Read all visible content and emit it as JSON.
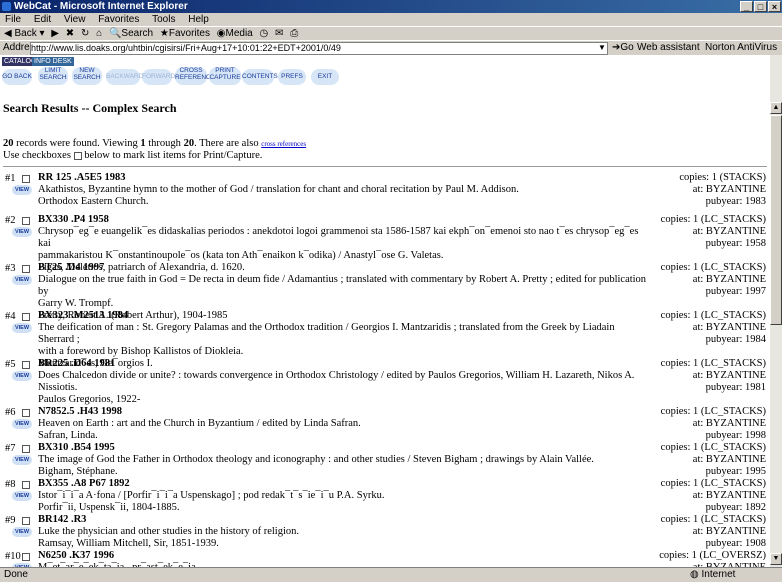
{
  "window": {
    "title": "WebCat - Microsoft Internet Explorer"
  },
  "menu": [
    "File",
    "Edit",
    "View",
    "Favorites",
    "Tools",
    "Help"
  ],
  "toolbar": {
    "back": "Back",
    "search": "Search",
    "favorites": "Favorites",
    "media": "Media"
  },
  "address": {
    "label": "Address",
    "url": "http://www.lis.doaks.org/uhtbin/cgisirsi/Fri+Aug+17+10:01:22+EDT+2001/0/49",
    "go": "Go",
    "assistant": "Web assistant",
    "antivirus": "Norton AntiVirus"
  },
  "nav": {
    "catalog": "CATALOG",
    "infodesk": "INFO DESK",
    "buttons": [
      "GO BACK",
      "LIMIT SEARCH",
      "NEW SEARCH",
      "BACKWARD",
      "FORWARD",
      "CROSS REFERENCE",
      "PRINT CAPTURE",
      "CONTENTS",
      "PREFS",
      "EXIT"
    ]
  },
  "heading": "Search Results -- Complex Search",
  "summary": {
    "count": "20",
    "a": " records were found. Viewing ",
    "from": "1",
    "b": " through ",
    "to": "20",
    "c": ". There are also ",
    "link": "cross references",
    "line2a": "Use checkboxes",
    "line2b": " below to mark list items for Print/Capture."
  },
  "view_label": "VIEW",
  "records": [
    {
      "num": "#1",
      "call": "RR 125 .A5E5 1983",
      "lines": [
        "Akathistos, Byzantine hymn to the mother of God / translation for chant and choral recitation by Paul M. Addison.",
        "Orthodox Eastern Church."
      ],
      "copies": "copies: 1 (STACKS)",
      "at": "at: BYZANTINE",
      "pubyear": "pubyear: 1983"
    },
    {
      "num": "#2",
      "call": "BX330 .P4 1958",
      "lines": [
        "Chrysop¯eg¯e euangelik¯es didaskalias periodos : anekdotoi logoi grammenoi sta 1586-1587 kai ekph¯on¯emenoi sto nao t¯es chrysop¯eg¯es kai",
        "pammakaristou K¯onstantinoupole¯os (kata ton Ath¯enaikon k¯odika) / Anastyl¯ose G. Valetas.",
        "Pigas, Meletios, patriarch of Alexandria, d. 1620."
      ],
      "copies": "copies: 1 (LC_STACKS)",
      "at": "at: BYZANTINE",
      "pubyear": "pubyear: 1958"
    },
    {
      "num": "#3",
      "call": "BT25 .D4 1997",
      "lines": [
        "Dialogue on the true faith in God = De recta in deum fide / Adamantius ; translated with commentary by Robert A. Pretty ; edited for publication by",
        "Garry W. Trompf.",
        "Pretty, Robert A. (Robert Arthur), 1904-1985"
      ],
      "copies": "copies: 1 (LC_STACKS)",
      "at": "at: BYZANTINE",
      "pubyear": "pubyear: 1997"
    },
    {
      "num": "#4",
      "call": "BX323 .M2513 1984",
      "lines": [
        "The deification of man : St. Gregory Palamas and the Orthodox tradition / Georgios I. Mantzaridis ; translated from the Greek by Liadain Sherrard ;",
        "with a foreword by Bishop Kallistos of Diokleia.",
        "Mantzarid¯es, Ge¯orgios I."
      ],
      "copies": "copies: 1 (LC_STACKS)",
      "at": "at: BYZANTINE",
      "pubyear": "pubyear: 1984"
    },
    {
      "num": "#5",
      "call": "BR225 .D64 1981",
      "lines": [
        "Does Chalcedon divide or unite? : towards convergence in Orthodox Christology / edited by Paulos Gregorios, William H. Lazareth, Nikos A.",
        "Nissiotis.",
        "Paulos Gregorios, 1922-"
      ],
      "copies": "copies: 1 (LC_STACKS)",
      "at": "at: BYZANTINE",
      "pubyear": "pubyear: 1981"
    },
    {
      "num": "#6",
      "call": "N7852.5 .H43 1998",
      "lines": [
        "Heaven on Earth : art and the Church in Byzantium / edited by Linda Safran.",
        "Safran, Linda."
      ],
      "copies": "copies: 1 (LC_STACKS)",
      "at": "at: BYZANTINE",
      "pubyear": "pubyear: 1998"
    },
    {
      "num": "#7",
      "call": "BX310 .B54 1995",
      "lines": [
        "The image of God the Father in Orthodox theology and iconography : and other studies / Steven Bigham ; drawings by Alain Vallée.",
        "Bigham, Stéphane."
      ],
      "copies": "copies: 1 (LC_STACKS)",
      "at": "at: BYZANTINE",
      "pubyear": "pubyear: 1995"
    },
    {
      "num": "#8",
      "call": "BX355 .A8 P67 1892",
      "lines": [
        "Istor¯i¯i¯a A·fona / [Porfir¯i¯i¯a Uspenskago] ; pod redak¯t¯s¯ie¯i¯u P.A. Syrku.",
        "Porfir¯ii, Uspensk¯ii, 1804-1885."
      ],
      "copies": "copies: 1 (LC_STACKS)",
      "at": "at: BYZANTINE",
      "pubyear": "pubyear: 1892"
    },
    {
      "num": "#9",
      "call": "BR142 .R3",
      "lines": [
        "Luke the physician and other studies in the history of religion.",
        "Ramsay, William Mitchell, Sir, 1851-1939."
      ],
      "copies": "copies: 1 (LC_STACKS)",
      "at": "at: BYZANTINE",
      "pubyear": "pubyear: 1908"
    },
    {
      "num": "#10",
      "call": "N6250 .K37 1996",
      "lines": [
        "M¯et¯ar¯e¯ek¯ta¯ia...pr¯ast¯ek¯e¯ia..."
      ],
      "copies": "copies: 1 (LC_OVERSZ)",
      "at": "at: BYZANTINE",
      "pubyear": ""
    }
  ],
  "status": {
    "left": "Done",
    "right": "Internet"
  }
}
